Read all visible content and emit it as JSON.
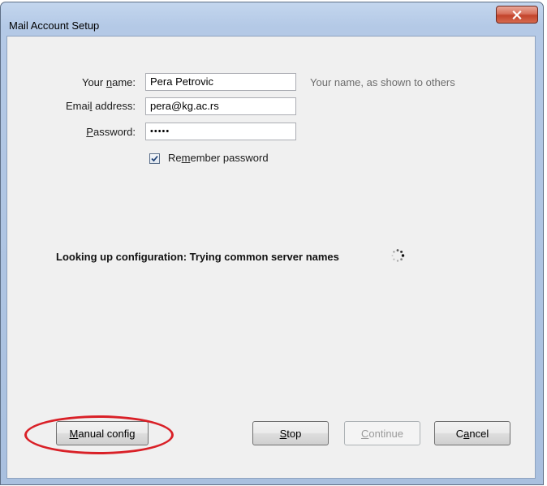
{
  "window": {
    "title": "Mail Account Setup"
  },
  "form": {
    "name_label_pre": "Your ",
    "name_label_key": "n",
    "name_label_post": "ame:",
    "name_value": "Pera Petrovic",
    "name_hint": "Your name, as shown to others",
    "email_label_pre": "Emai",
    "email_label_key": "l",
    "email_label_post": " address:",
    "email_value": "pera@kg.ac.rs",
    "password_label_key": "P",
    "password_label_post": "assword:",
    "password_value": "•••••",
    "remember_pre": "Re",
    "remember_key": "m",
    "remember_post": "ember password",
    "remember_checked": true
  },
  "status": {
    "text": "Looking up configuration: Trying common server names"
  },
  "buttons": {
    "manual_key": "M",
    "manual_rest": "anual config",
    "stop_key": "S",
    "stop_rest": "top",
    "continue_key": "C",
    "continue_rest": "ontinue",
    "cancel_pre": "C",
    "cancel_key": "a",
    "cancel_post": "ncel"
  },
  "colors": {
    "highlight": "#d92027",
    "close_button": "#c2432b",
    "window_frame": "#b4c9e6"
  }
}
